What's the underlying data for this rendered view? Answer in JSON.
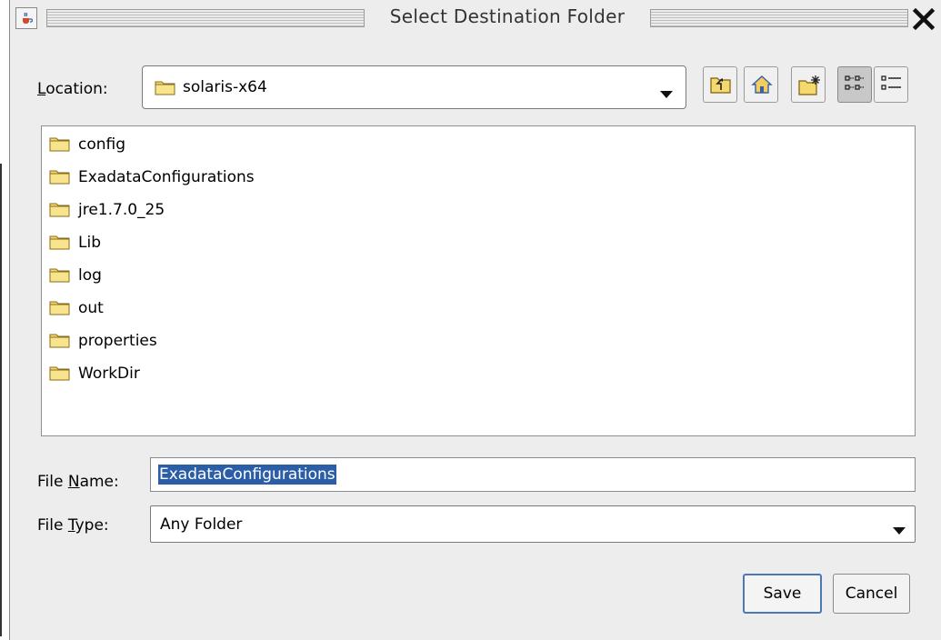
{
  "window": {
    "title": "Select Destination Folder",
    "icons": {
      "app": "java-cup-icon",
      "close": "close-icon"
    }
  },
  "location": {
    "label_mnemonic": "L",
    "label_rest": "ocation:",
    "value": "solaris-x64",
    "icon": "folder-icon",
    "dropdown_icon": "chevron-down-icon"
  },
  "toolbar": {
    "buttons": [
      {
        "name": "up-one-level",
        "icon": "folder-up-icon"
      },
      {
        "name": "home",
        "icon": "home-icon"
      },
      {
        "name": "create-new-folder",
        "icon": "new-folder-icon"
      },
      {
        "name": "list-view",
        "icon": "list-view-icon",
        "selected": true
      },
      {
        "name": "details-view",
        "icon": "details-view-icon",
        "selected": false
      }
    ]
  },
  "files": [
    {
      "name": "config",
      "icon": "folder-icon"
    },
    {
      "name": "ExadataConfigurations",
      "icon": "folder-icon"
    },
    {
      "name": "jre1.7.0_25",
      "icon": "folder-icon"
    },
    {
      "name": "Lib",
      "icon": "folder-icon"
    },
    {
      "name": "log",
      "icon": "folder-icon"
    },
    {
      "name": "out",
      "icon": "folder-icon"
    },
    {
      "name": "properties",
      "icon": "folder-icon"
    },
    {
      "name": "WorkDir",
      "icon": "folder-icon"
    }
  ],
  "file_name": {
    "label_pre": "File ",
    "label_mnemonic": "N",
    "label_rest": "ame:",
    "value": "ExadataConfigurations",
    "selected": true
  },
  "file_type": {
    "label_pre": "File ",
    "label_mnemonic": "T",
    "label_rest": "ype:",
    "value": "Any Folder",
    "dropdown_icon": "chevron-down-icon"
  },
  "buttons": {
    "save": "Save",
    "cancel": "Cancel"
  },
  "colors": {
    "dialog_bg": "#ededed",
    "selection": "#2c5ea8",
    "default_button_border": "#4a78b8",
    "folder_fill": "#f5d96e"
  }
}
